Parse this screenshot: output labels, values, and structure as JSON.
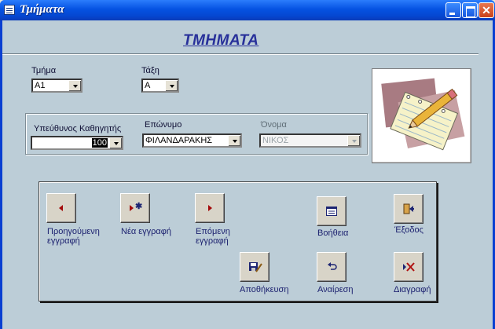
{
  "window": {
    "title": "Τμήματα"
  },
  "form": {
    "heading": "ΤΜΗΜΑΤΑ"
  },
  "fields": {
    "tmima": {
      "label": "Τμήμα",
      "value": "A1"
    },
    "taxi": {
      "label": "Τάξη",
      "value": "A"
    },
    "ypefthynos": {
      "label": "Υπεύθυνος Καθηγητής",
      "value": "100"
    },
    "eponymo": {
      "label": "Επώνυμο",
      "value": "ΦΙΛΑΝΔΑΡΑΚΗΣ"
    },
    "onoma": {
      "label": "Όνομα",
      "value": "ΝΙΚΟΣ"
    }
  },
  "buttons": {
    "previous": "Προηγούμενη εγγραφή",
    "new": "Νέα εγγραφή",
    "next": "Επόμενη εγγραφή",
    "help": "Βοήθεια",
    "exit": "Έξοδος",
    "save": "Αποθήκευση",
    "undo": "Αναίρεση",
    "delete": "Διαγραφή"
  },
  "colors": {
    "accent_text": "#27309a",
    "form_background": "#bccdd7",
    "arrow_red": "#a40a0a"
  }
}
